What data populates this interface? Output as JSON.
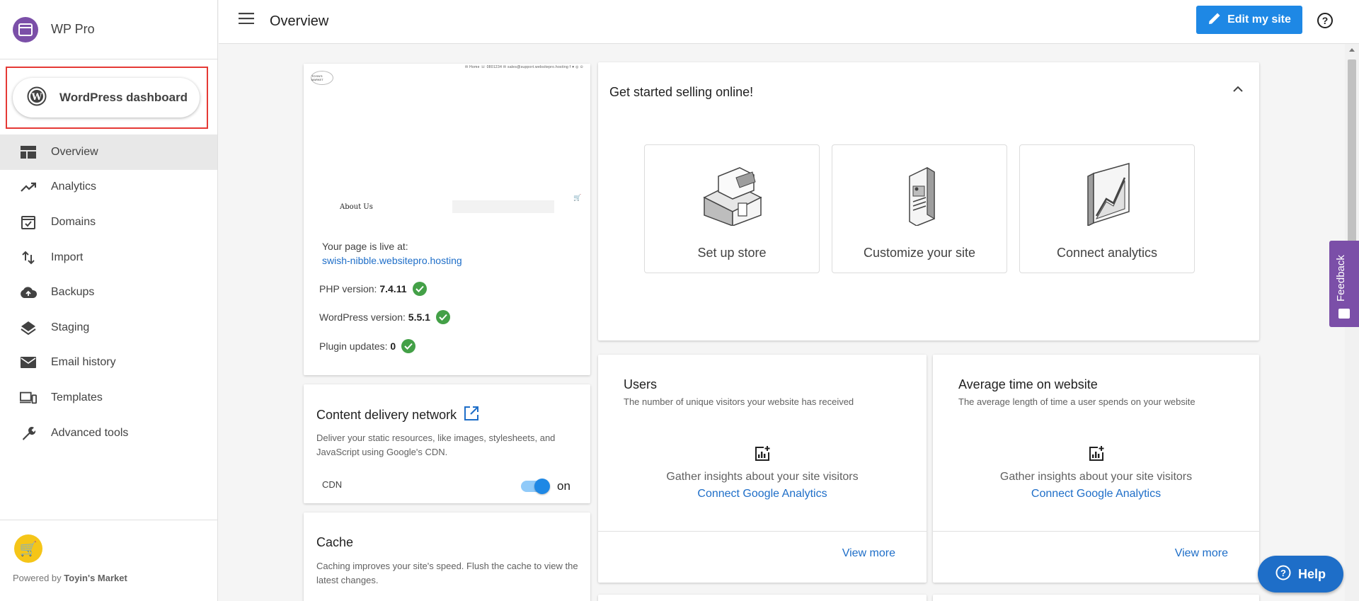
{
  "brand": {
    "name": "WP Pro",
    "color": "#7b4fa8"
  },
  "wp_dashboard": {
    "label": "WordPress dashboard"
  },
  "sidebar": {
    "items": [
      {
        "label": "Overview",
        "icon": "dashboard-icon",
        "active": true
      },
      {
        "label": "Analytics",
        "icon": "trending-up-icon"
      },
      {
        "label": "Domains",
        "icon": "check-box-icon"
      },
      {
        "label": "Import",
        "icon": "swap-vert-icon"
      },
      {
        "label": "Backups",
        "icon": "cloud-upload-icon"
      },
      {
        "label": "Staging",
        "icon": "layers-icon"
      },
      {
        "label": "Email history",
        "icon": "mail-icon"
      },
      {
        "label": "Templates",
        "icon": "devices-icon"
      },
      {
        "label": "Advanced tools",
        "icon": "wrench-icon"
      }
    ],
    "footer": {
      "powered_prefix": "Powered by",
      "powered_name": "Toyin's Market"
    }
  },
  "header": {
    "title": "Overview",
    "edit_label": "Edit my site"
  },
  "preview": {
    "thumb_topline": "✉ Home  ☏ 0801234  ✉ sales@support.websitepro.hosting  f ♥ ◎ ⊙",
    "thumb_logo": "TOYIN'S MARKET",
    "thumb_about": "About Us",
    "live_label": "Your page is live at:",
    "live_url": "swish-nibble.websitepro.hosting",
    "php_label": "PHP version:",
    "php_value": "7.4.11",
    "wp_label": "WordPress version:",
    "wp_value": "5.5.1",
    "plugin_label": "Plugin updates:",
    "plugin_value": "0"
  },
  "cdn": {
    "title": "Content delivery network",
    "description": "Deliver your static resources, like images, stylesheets, and JavaScript using Google's CDN.",
    "label": "CDN",
    "state": "on"
  },
  "cache": {
    "title": "Cache",
    "description": "Caching improves your site's speed. Flush the cache to view the latest changes."
  },
  "selling": {
    "title": "Get started selling online!",
    "tiles": [
      {
        "label": "Set up store",
        "icon": "store-illustration"
      },
      {
        "label": "Customize your site",
        "icon": "customize-illustration"
      },
      {
        "label": "Connect analytics",
        "icon": "analytics-illustration"
      }
    ]
  },
  "stats": [
    {
      "title": "Users",
      "subtitle": "The number of unique visitors your website has received",
      "message": "Gather insights about your site visitors",
      "link": "Connect Google Analytics",
      "more": "View more"
    },
    {
      "title": "Average time on website",
      "subtitle": "The average length of time a user spends on your website",
      "message": "Gather insights about your site visitors",
      "link": "Connect Google Analytics",
      "more": "View more"
    }
  ],
  "feedback": {
    "label": "Feedback"
  },
  "help": {
    "label": "Help"
  },
  "colors": {
    "accent": "#1e88e5",
    "link": "#1e6ec8",
    "success": "#43a047",
    "highlight": "#e53935"
  }
}
